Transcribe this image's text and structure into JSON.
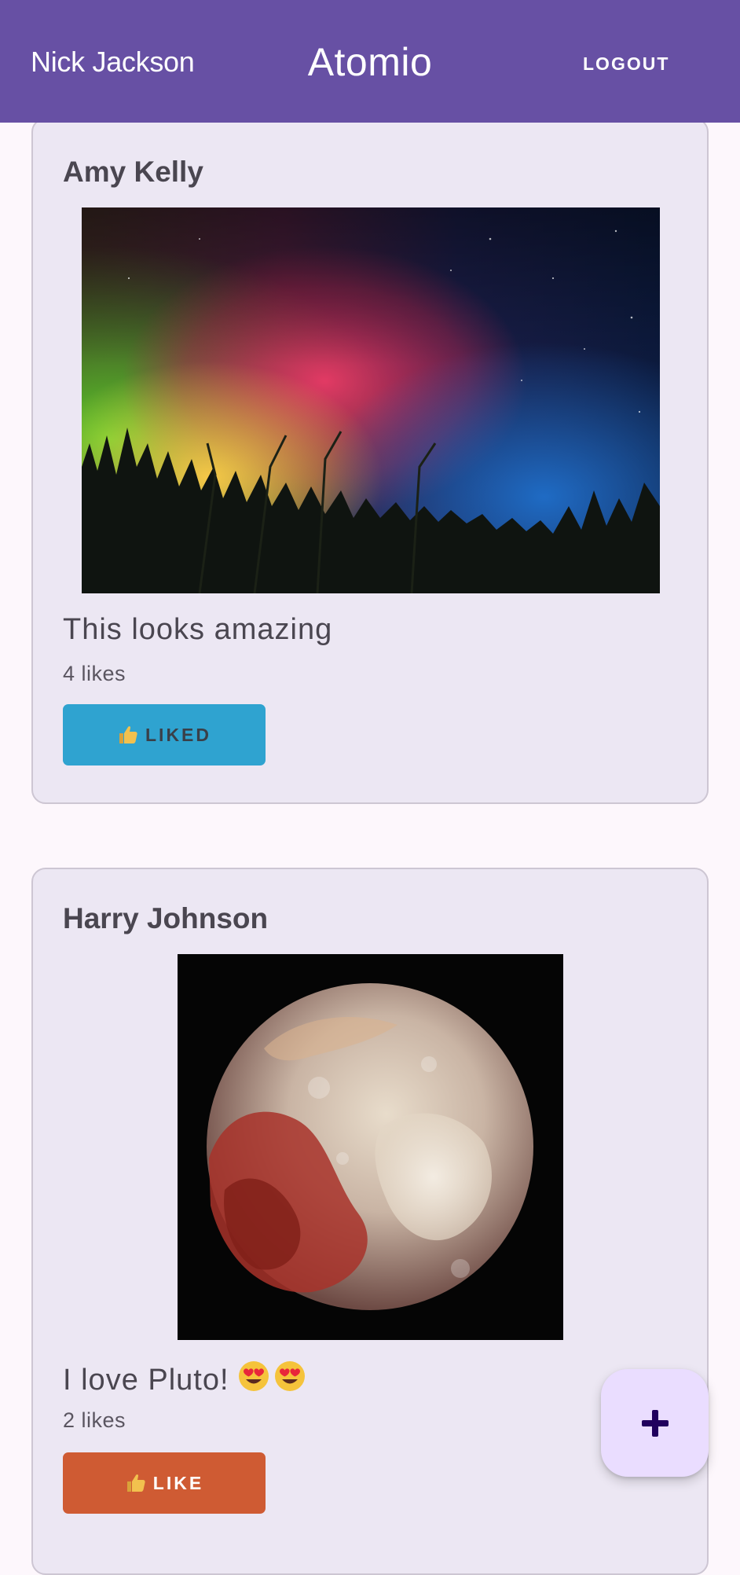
{
  "header": {
    "user_name": "Nick Jackson",
    "app_title": "Atomio",
    "logout_label": "LOGOUT"
  },
  "posts": [
    {
      "author": "Amy Kelly",
      "image": "aurora-borealis-over-forest",
      "caption": "This looks amazing",
      "likes": "4 likes",
      "button_label": "LIKED",
      "button_icon": "thumbs-up-icon",
      "button_color": "#2fa3d0"
    },
    {
      "author": "Harry Johnson",
      "image": "pluto-planet",
      "caption": "I love Pluto!",
      "caption_emoji": "heart-eyes-emoji",
      "likes": "2 likes",
      "button_label": "LIKE",
      "button_icon": "thumbs-up-icon",
      "button_color": "#cf5b33"
    }
  ],
  "fab": {
    "icon": "plus-icon"
  },
  "colors": {
    "app_bar": "#6750a4",
    "card_background": "#ece7f3",
    "fab_background": "#eaddff"
  }
}
